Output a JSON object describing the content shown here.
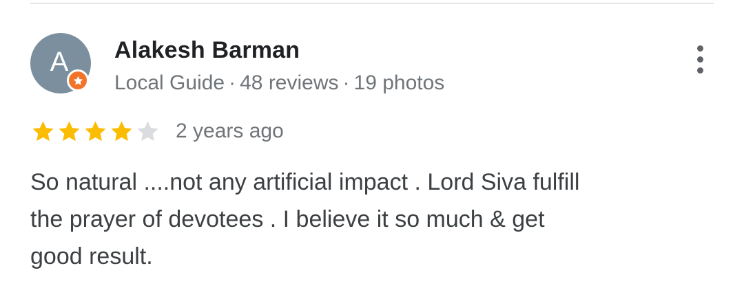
{
  "review": {
    "author": {
      "name": "Alakesh Barman",
      "avatar_letter": "A",
      "avatar_color": "#7b8f9e",
      "badge_icon": "local-guide-star-icon",
      "badge_color": "#f2742a",
      "role": "Local Guide",
      "separator": "·",
      "reviews_count": "48 reviews",
      "photos_count": "19 photos"
    },
    "rating": {
      "stars": 4,
      "max_stars": 5,
      "filled_color": "#fbbc04",
      "empty_color": "#dadce0"
    },
    "time_ago": "2 years ago",
    "text": "So natural ....not any artificial impact .  Lord Siva fulfill\nthe prayer of devotees . I believe it so much & get\ngood result.",
    "more_icon": "more-vert-icon"
  }
}
